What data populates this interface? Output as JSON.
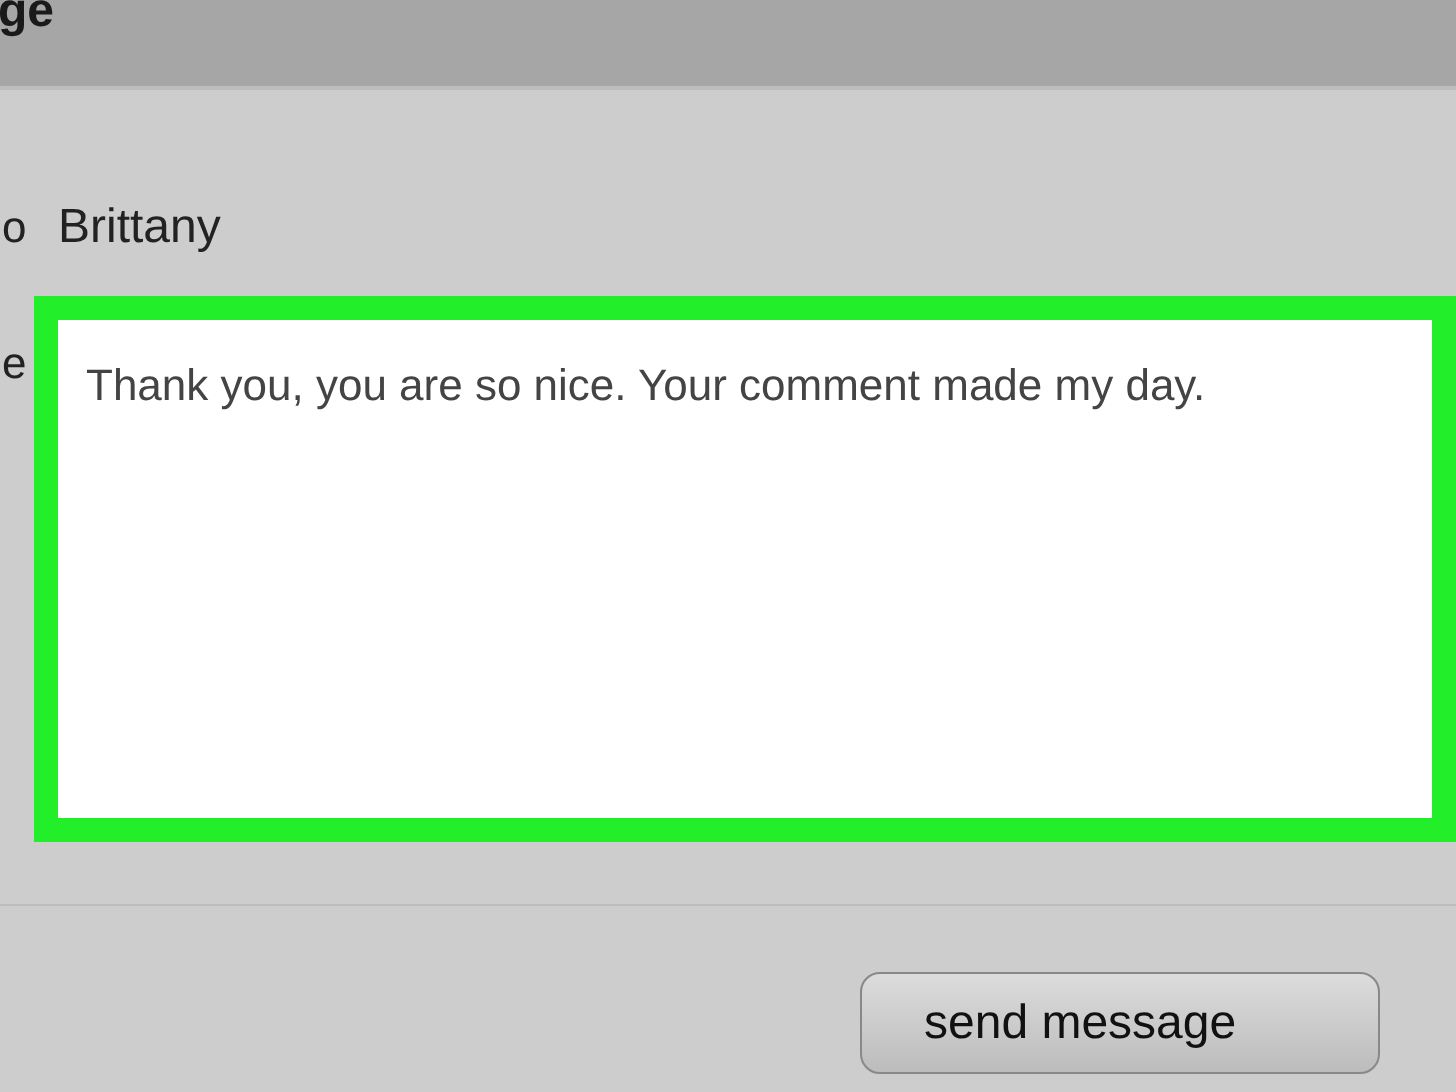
{
  "window": {
    "title": "ge"
  },
  "fields": [
    {
      "label": "o",
      "value": "Brittany",
      "kind": "text"
    },
    {
      "label": "e",
      "value": "Thank you, you are so nice. Your comment made my day.",
      "kind": "textarea",
      "highlighted": true
    }
  ],
  "buttons": [
    "send message"
  ]
}
